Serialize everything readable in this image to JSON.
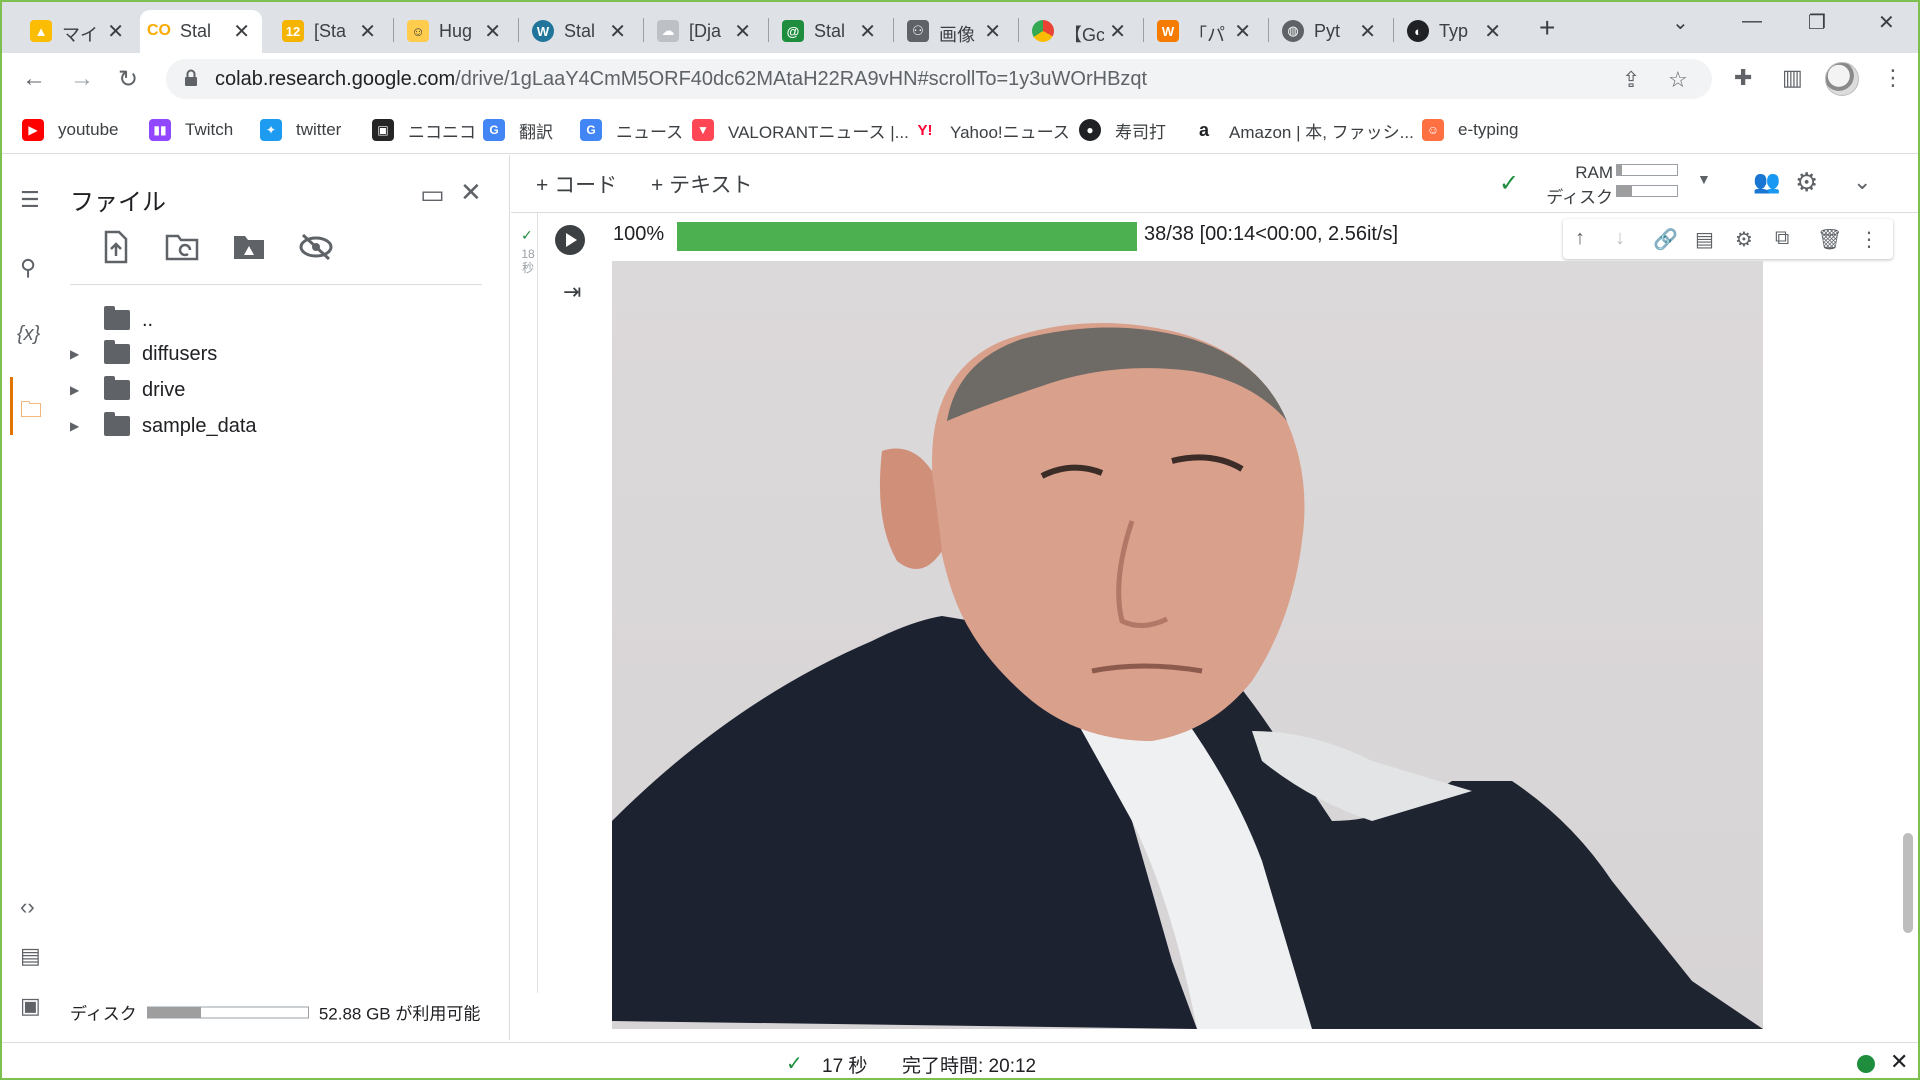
{
  "tabs": [
    {
      "title": "マイ",
      "active": false,
      "icon": "google-drive-icon",
      "color": "#1e8e3e"
    },
    {
      "title": "Stal",
      "active": true,
      "icon": "colab-icon",
      "color": "#f9ab00"
    },
    {
      "title": "[Sta",
      "active": false,
      "icon": "12-icon",
      "color": "#f4b400"
    },
    {
      "title": "Hug",
      "active": false,
      "icon": "huggingface-icon",
      "color": "#ffcc4d"
    },
    {
      "title": "Stal",
      "active": false,
      "icon": "wordpress-icon",
      "color": "#21759b"
    },
    {
      "title": "[Dja",
      "active": false,
      "icon": "cloud-icon",
      "color": "#9aa0a6"
    },
    {
      "title": "Stal",
      "active": false,
      "icon": "at-icon",
      "color": "#1e8e3e"
    },
    {
      "title": "画像",
      "active": false,
      "icon": "share-icon",
      "color": "#5f6368"
    },
    {
      "title": "【Gc",
      "active": false,
      "icon": "chrome-icon",
      "color": "#4285f4"
    },
    {
      "title": "「パ",
      "active": false,
      "icon": "w-icon",
      "color": "#f57c00"
    },
    {
      "title": "Pyt",
      "active": false,
      "icon": "globe-icon",
      "color": "#5f6368"
    },
    {
      "title": "Typ",
      "active": false,
      "icon": "typing-icon",
      "color": "#202124"
    }
  ],
  "address": {
    "host": "colab.research.google.com",
    "path": "/drive/1gLaaY4CmM5ORF40dc62MAtaH22RA9vHN#scrollTo=1y3uWOrHBzqt"
  },
  "bookmarks": [
    {
      "label": "youtube",
      "icon": "youtube-icon",
      "color": "#ff0000"
    },
    {
      "label": "Twitch",
      "icon": "twitch-icon",
      "color": "#9146ff"
    },
    {
      "label": "twitter",
      "icon": "twitter-icon",
      "color": "#1d9bf0"
    },
    {
      "label": "ニコニコ",
      "icon": "niconico-icon",
      "color": "#252525"
    },
    {
      "label": "翻訳",
      "icon": "translate-icon",
      "color": "#4285f4"
    },
    {
      "label": "ニュース",
      "icon": "news-icon",
      "color": "#4285f4"
    },
    {
      "label": "VALORANTニュース |...",
      "icon": "valorant-icon",
      "color": "#ff4655"
    },
    {
      "label": "Yahoo!ニュース",
      "icon": "yahoo-icon",
      "color": "#ff0033"
    },
    {
      "label": "寿司打",
      "icon": "sushi-icon",
      "color": "#202124"
    },
    {
      "label": "Amazon | 本, ファッシ...",
      "icon": "amazon-icon",
      "color": "#202124"
    },
    {
      "label": "e-typing",
      "icon": "etyping-icon",
      "color": "#ff7043"
    }
  ],
  "files": {
    "title": "ファイル",
    "tree": [
      {
        "name": "..",
        "type": "parent"
      },
      {
        "name": "diffusers",
        "type": "folder"
      },
      {
        "name": "drive",
        "type": "folder"
      },
      {
        "name": "sample_data",
        "type": "folder"
      }
    ],
    "disk_label": "ディスク",
    "disk_free": "52.88 GB が利用可能",
    "disk_used_fraction": 0.33
  },
  "notebook": {
    "add_code": "+ コード",
    "add_text": "+ テキスト",
    "ram_label": "RAM",
    "disk_label": "ディスク",
    "ram_used_fraction": 0.08,
    "disk_used_fraction": 0.25,
    "exec_time": "18\n秒",
    "progress_pct": "100%",
    "progress_fraction": 1.0,
    "progress_text": "38/38 [00:14<00:00, 2.56it/s]"
  },
  "status": {
    "elapsed": "17 秒",
    "completed": "完了時間: 20:12",
    "dot_color": "#1e8e3e"
  }
}
